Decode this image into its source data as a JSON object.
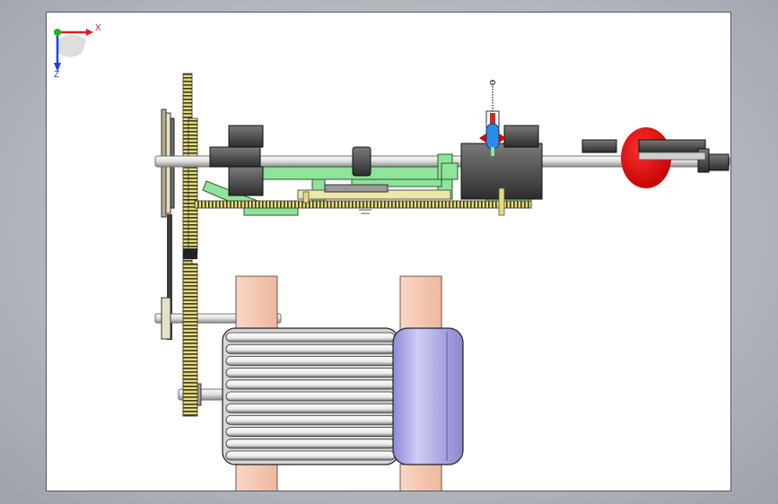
{
  "triad": {
    "x_label": "X",
    "z_label": "Z"
  },
  "colors": {
    "viewport_bg": "#ffffff",
    "frame": "#55585e",
    "shaft": "#e6e6e6",
    "bracket_green": "#8fe39a",
    "gear_yellow": "#d8d48a",
    "dark_part": "#4a4a4a",
    "motor_blue": "#b9b6ee",
    "motor_fins": "#f2f2f2",
    "motor_mount": "#f6c9b3",
    "cam_red": "#e00000",
    "axis_x": "#e01c1c",
    "axis_y": "#1fb51f",
    "axis_z": "#1f3fe0"
  },
  "icons": [
    "coordinate-triad-icon"
  ]
}
